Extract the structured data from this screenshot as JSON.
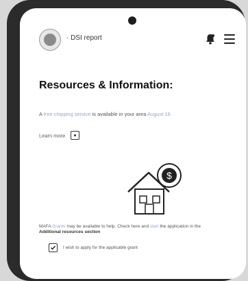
{
  "header": {
    "title": "· DSI report",
    "icons": [
      "logo-icon",
      "bell-icon",
      "menu-icon"
    ]
  },
  "page": {
    "title": "Resources & Information:",
    "notice": {
      "prefix": "A",
      "link": "free chipping service",
      "middle": "is available in your area",
      "date": "August 16"
    },
    "learn_more": "Learn more"
  },
  "grant": {
    "prefix": "MAFA",
    "link1": "Grants",
    "mid1": "may be available to help.  Check here and",
    "link2": "start",
    "mid2": "the application in the",
    "bold": "Additional resources section",
    "end": ""
  },
  "checkbox": {
    "label": "I wish to apply for the applicable grant",
    "checked": true
  },
  "colors": {
    "link": "#8aa8d6",
    "frame": "#2b2b2b"
  }
}
